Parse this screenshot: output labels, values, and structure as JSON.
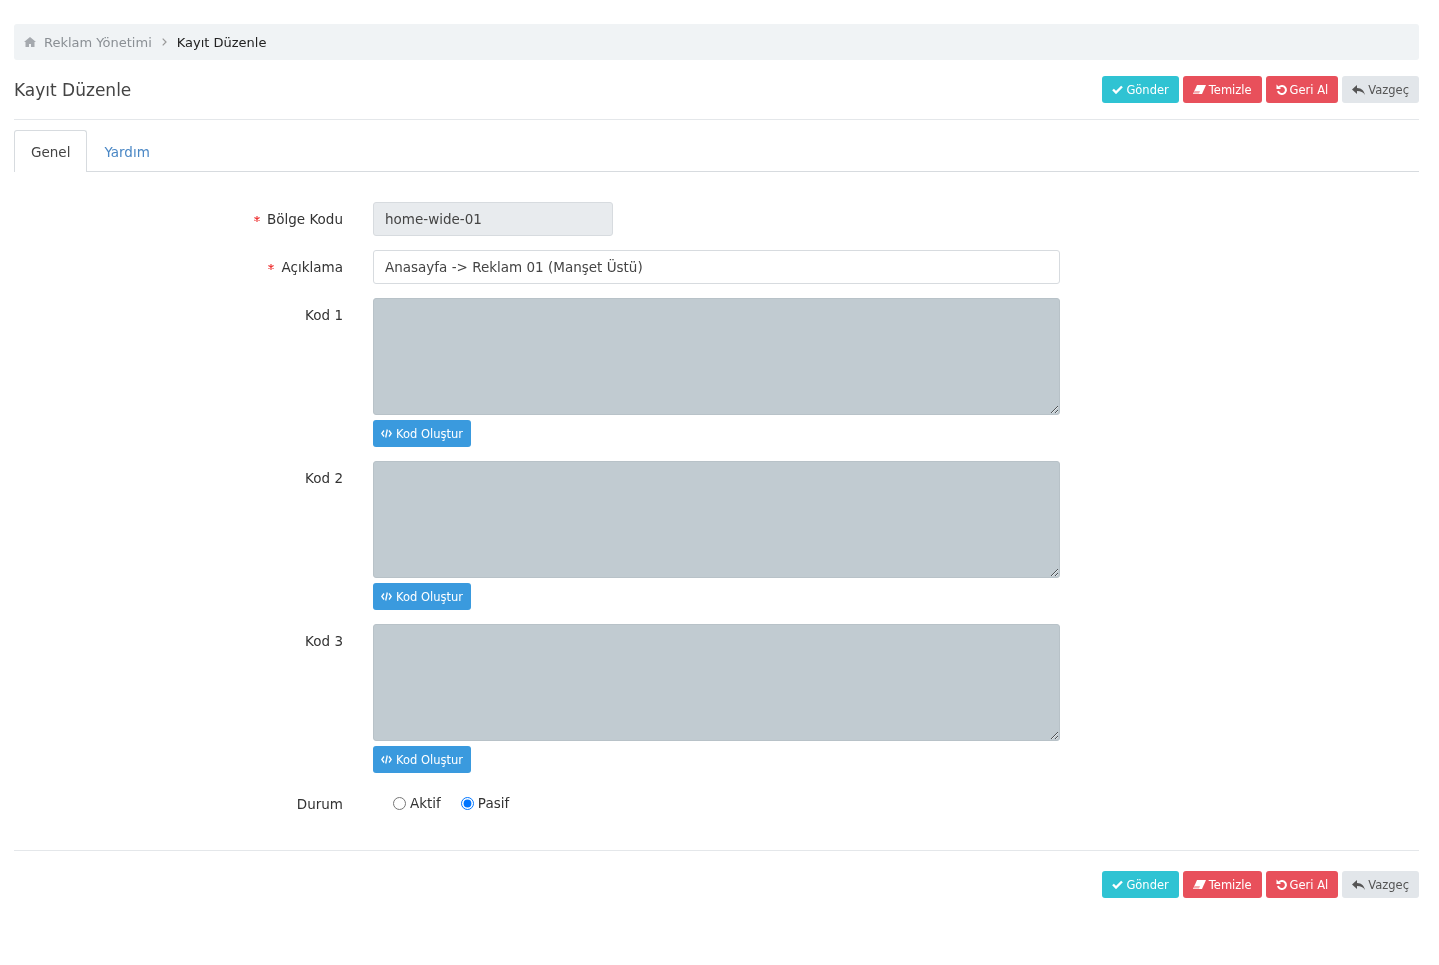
{
  "breadcrumb": [
    {
      "label": "Reklam Yönetimi",
      "kind": "home"
    },
    {
      "label": "Kayıt Düzenle",
      "kind": "current"
    }
  ],
  "page_title": "Kayıt Düzenle",
  "top_actions": [
    {
      "label": "Gönder",
      "kind": "submit"
    },
    {
      "label": "Temizle",
      "kind": "clear"
    },
    {
      "label": "Geri Al",
      "kind": "undo"
    },
    {
      "label": "Vazgeç",
      "kind": "cancel"
    }
  ],
  "tabs": [
    {
      "label": "Genel",
      "selected": true
    },
    {
      "label": "Yardım",
      "selected": false
    }
  ],
  "fields": [
    {
      "label": "Bölge Kodu",
      "required": true,
      "kind": "readonly",
      "value": "home-wide-01"
    },
    {
      "label": "Açıklama",
      "required": true,
      "kind": "text",
      "value": "Anasayfa -> Reklam 01 (Manşet Üstü)"
    },
    {
      "label": "Kod 1",
      "required": false,
      "kind": "code",
      "button": "Kod Oluştur"
    },
    {
      "label": "Kod 2",
      "required": false,
      "kind": "code",
      "button": "Kod Oluştur"
    },
    {
      "label": "Kod 3",
      "required": false,
      "kind": "code",
      "button": "Kod Oluştur"
    },
    {
      "label": "Durum",
      "required": false,
      "kind": "radio",
      "options": [
        {
          "label": "Aktif",
          "selected": false
        },
        {
          "label": "Pasif",
          "selected": true
        }
      ]
    }
  ],
  "bottom_actions": [
    {
      "label": "Gönder",
      "kind": "submit"
    },
    {
      "label": "Temizle",
      "kind": "clear"
    },
    {
      "label": "Geri Al",
      "kind": "undo"
    },
    {
      "label": "Vazgeç",
      "kind": "cancel"
    }
  ]
}
